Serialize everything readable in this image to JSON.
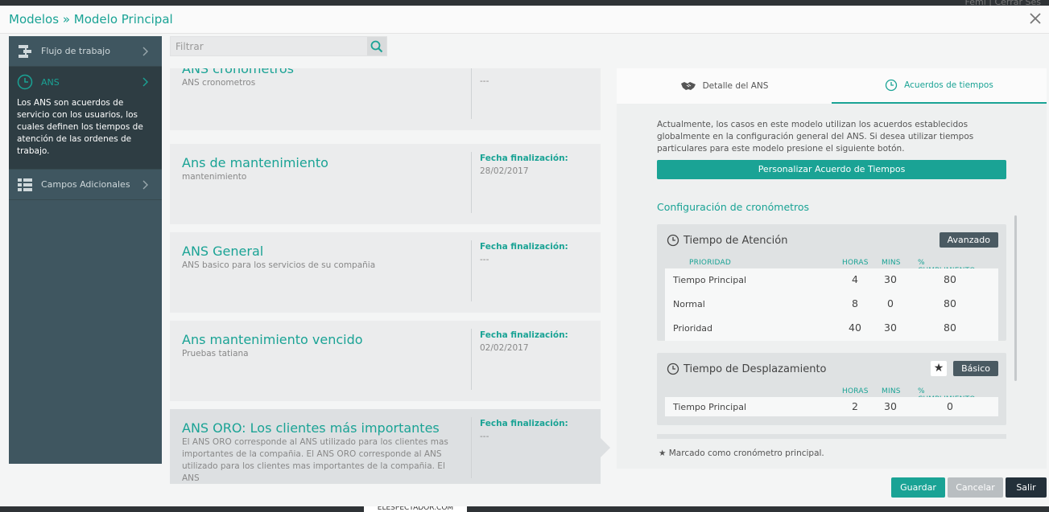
{
  "header": {
    "crumb_root": "Modelos",
    "crumb_sep": "»",
    "crumb_current": "Modelo Principal"
  },
  "background": {
    "peek_text": "Femi  |  Cerrar Ses",
    "bottom_tag": "ELESPECTADOR.COM"
  },
  "sidebar": {
    "items": [
      {
        "label": "Flujo de trabajo",
        "icon": "workflow-icon"
      },
      {
        "label": "ANS",
        "icon": "clock-icon",
        "description": "Los ANS son acuerdos de servicio con los usuarios, los cuales definen los tiempos de atención de las ordenes de trabajo."
      },
      {
        "label": "Campos Adicionales",
        "icon": "list-icon"
      }
    ]
  },
  "filter": {
    "placeholder": "Filtrar"
  },
  "cards": [
    {
      "title": "ANS cronometros",
      "desc": "ANS cronometros",
      "flabel": "",
      "fval": "---"
    },
    {
      "title": "Ans de mantenimiento",
      "desc": "mantenimiento",
      "flabel": "Fecha finalización:",
      "fval": "28/02/2017"
    },
    {
      "title": "ANS General",
      "desc": "ANS basico para los servicios de su compañia",
      "flabel": "Fecha finalización:",
      "fval": "---"
    },
    {
      "title": "Ans mantenimiento vencido",
      "desc": "Pruebas tatiana",
      "flabel": "Fecha finalización:",
      "fval": "02/02/2017"
    },
    {
      "title": "ANS ORO: Los clientes más importantes",
      "desc": "El ANS ORO corresponde al ANS utilizado para los clientes mas importantes de la compañia. El ANS ORO corresponde al ANS utilizado para los clientes mas importantes de la compañia. El ANS",
      "flabel": "Fecha finalización:",
      "fval": "---"
    }
  ],
  "detail": {
    "tabs": [
      {
        "label": "Detalle del ANS",
        "icon": "handshake-icon"
      },
      {
        "label": "Acuerdos de tiempos",
        "icon": "clock-icon"
      }
    ],
    "intro": "Actualmente, los casos en este modelo utilizan los acuerdos establecidos globalmente en la configuración general del ANS. Si desea utilizar tiempos particulares para este modelo presione el siguiente botón.",
    "custom_button": "Personalizar Acuerdo de Tiempos",
    "config_title": "Configuración de cronómetros",
    "columns": {
      "priority": "PRIORIDAD",
      "hours": "HORAS",
      "mins": "MINS",
      "compliance": "% CUMPLIMIENTO"
    },
    "timers": [
      {
        "title": "Tiempo de Atención",
        "mode": "Avanzado",
        "starred": false,
        "rows": [
          {
            "name": "Tiempo Principal",
            "hours": "4",
            "mins": "30",
            "pct": "80"
          },
          {
            "name": "Normal",
            "hours": "8",
            "mins": "0",
            "pct": "80"
          },
          {
            "name": "Prioridad",
            "hours": "40",
            "mins": "30",
            "pct": "80"
          }
        ]
      },
      {
        "title": "Tiempo de Desplazamiento",
        "mode": "Básico",
        "starred": true,
        "star": "★",
        "rows": [
          {
            "name": "Tiempo Principal",
            "hours": "2",
            "mins": "30",
            "pct": "0"
          }
        ]
      }
    ],
    "footnote": "★ Marcado como cronómetro principal."
  },
  "footer": {
    "save": "Guardar",
    "cancel": "Cancelar",
    "exit": "Salir"
  },
  "colors": {
    "accent": "#1aa395",
    "sidebar": "#3f5660",
    "dark_button": "#4a5a62"
  }
}
